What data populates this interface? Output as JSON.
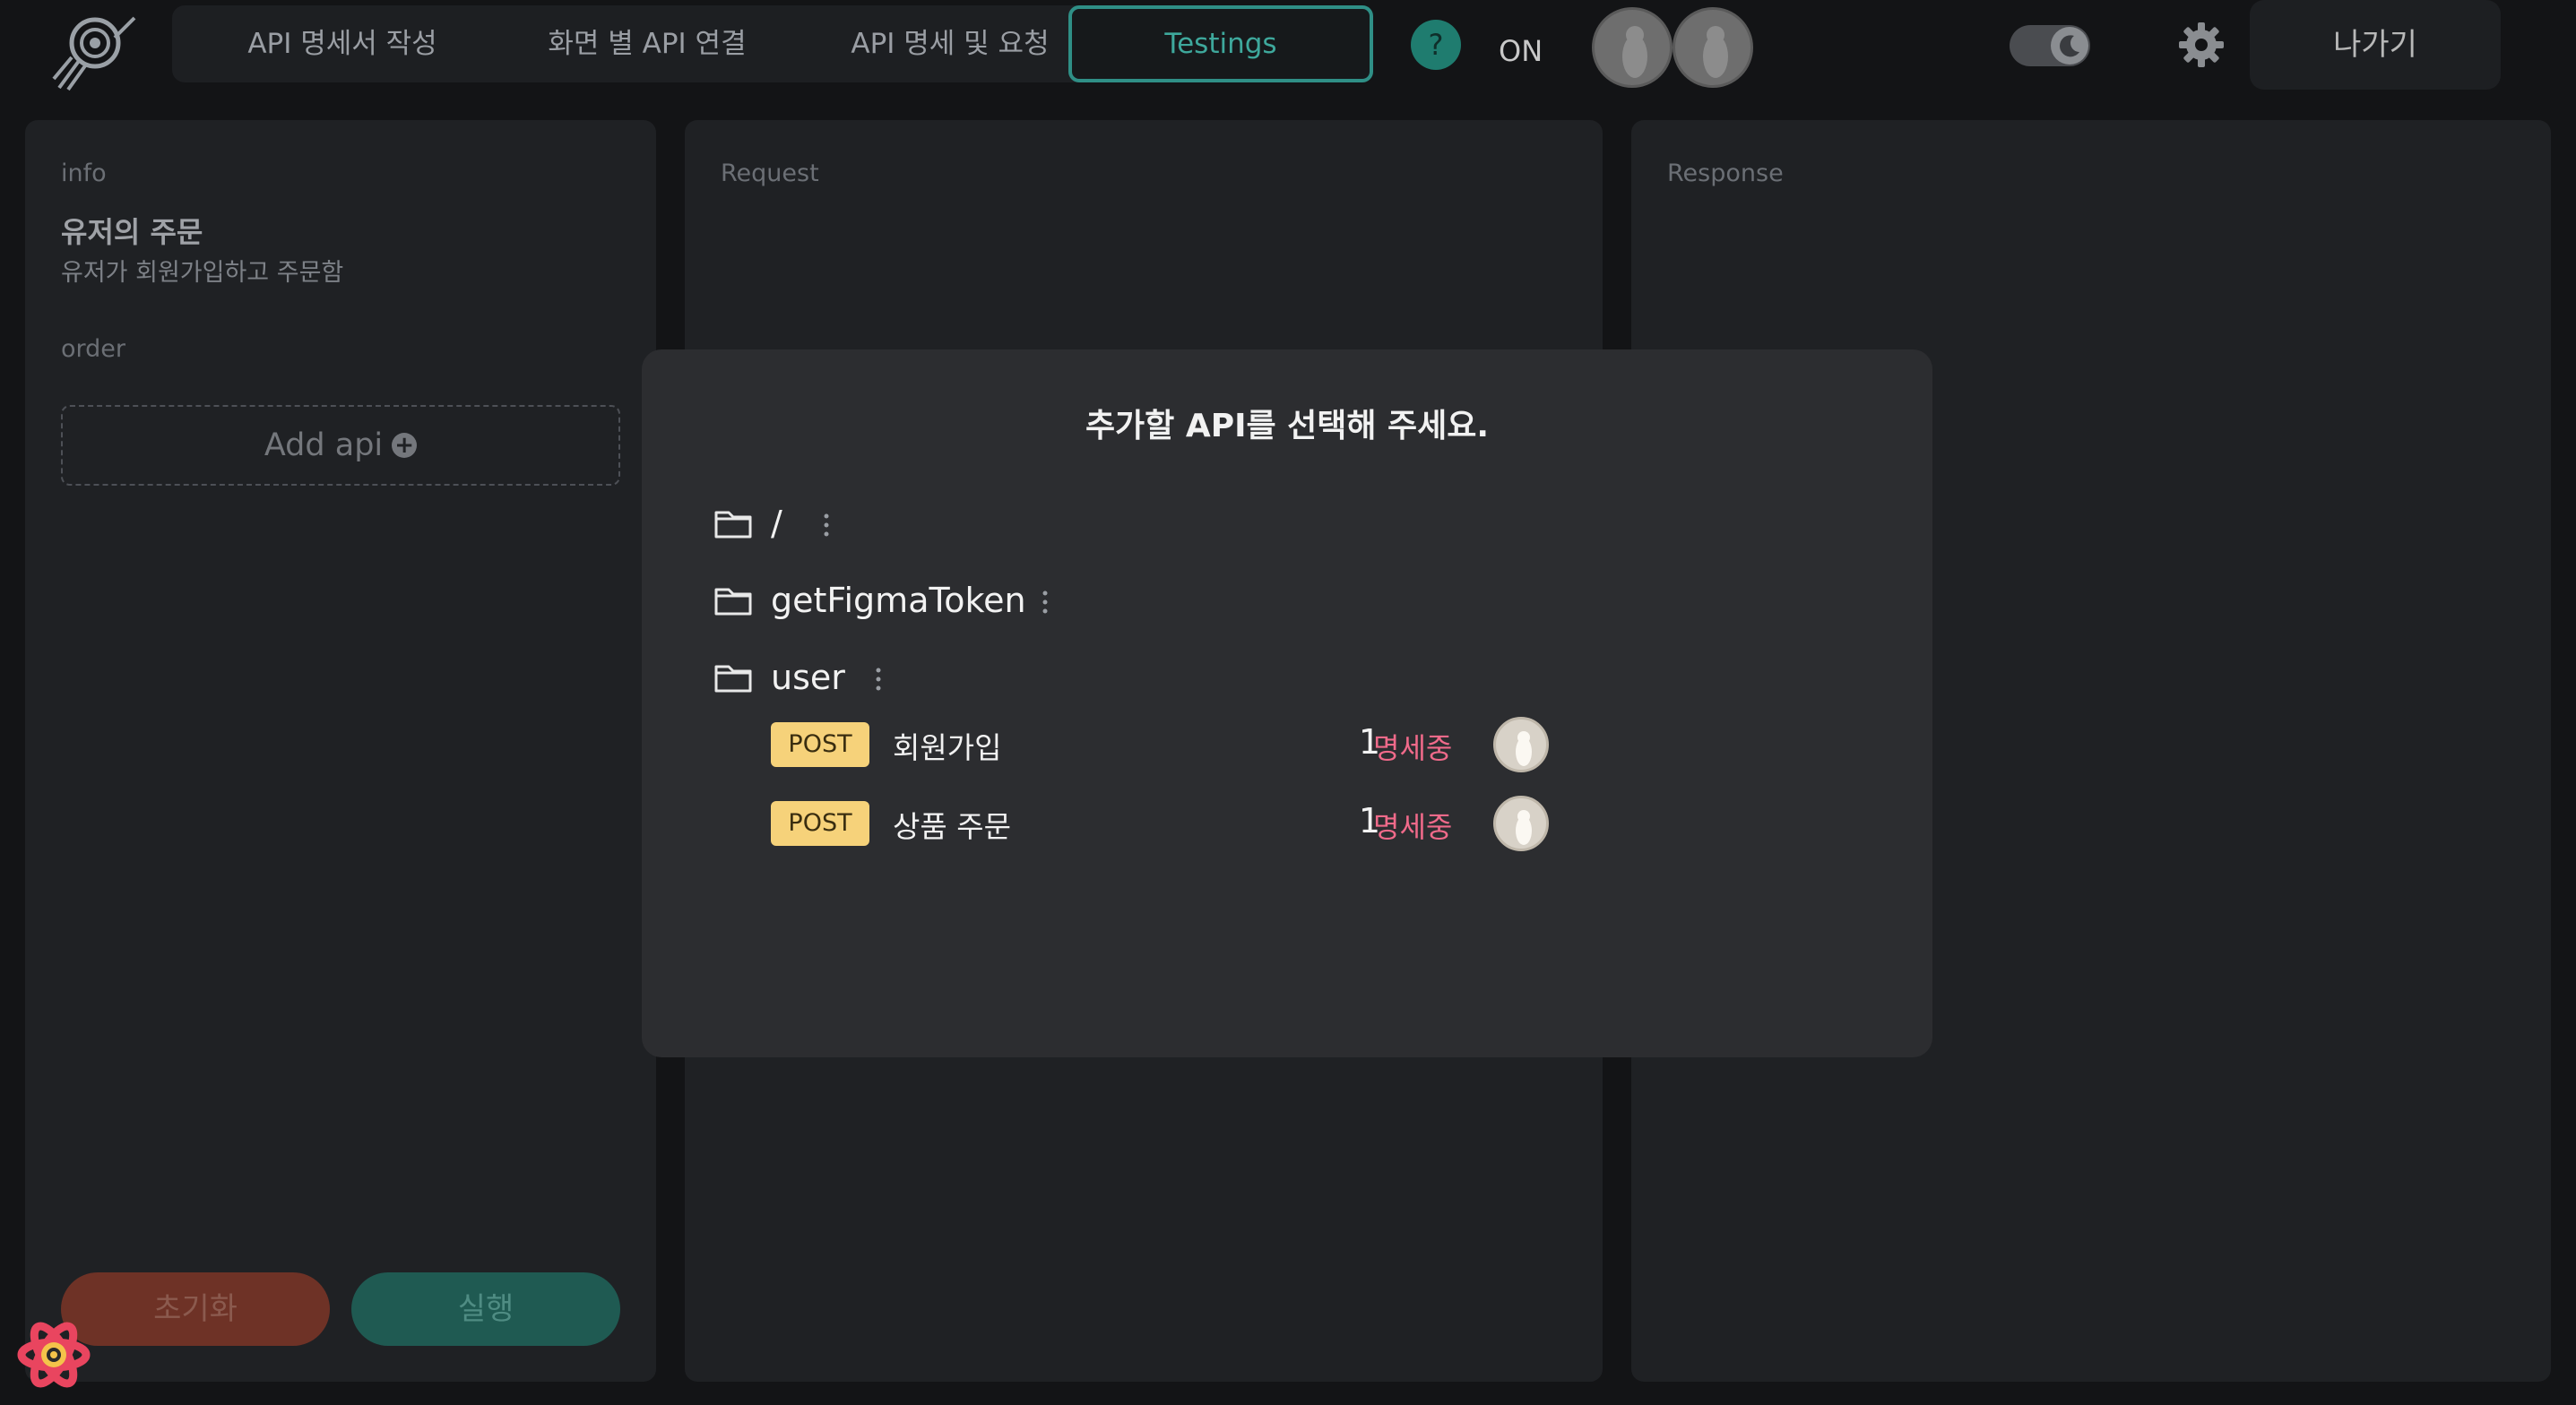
{
  "nav": {
    "tabs": [
      {
        "label": "API 명세서 작성"
      },
      {
        "label": "화면 별 API 연결"
      },
      {
        "label": "API 명세 및 요청"
      },
      {
        "label": "Testings"
      }
    ],
    "help_label": "?",
    "live_status": "ON",
    "exit_label": "나가기",
    "icons": [
      "snail-logo-icon",
      "help-icon",
      "avatar-icon",
      "theme-toggle-moon-icon",
      "gear-icon"
    ]
  },
  "info_panel": {
    "label": "info",
    "title": "유저의 주문",
    "description": "유저가 회원가입하고 주문함",
    "order_label": "order",
    "add_api_label": "Add api",
    "reset_label": "초기화",
    "run_label": "실행"
  },
  "request_panel": {
    "label": "Request"
  },
  "response_panel": {
    "label": "Response"
  },
  "modal": {
    "title": "추가할 API를 선택해 주세요.",
    "folders": [
      {
        "name": "/"
      },
      {
        "name": "getFigmaToken"
      },
      {
        "name": "user"
      }
    ],
    "apis": [
      {
        "method": "POST",
        "name": "회원가입",
        "count": "1",
        "status": "명세중"
      },
      {
        "method": "POST",
        "name": "상품 주문",
        "count": "1",
        "status": "명세중"
      }
    ]
  },
  "colors": {
    "accent_teal": "#2f8f86",
    "method_post": "#f6d27a",
    "status_pink": "#f06a8a",
    "background": "#131416"
  }
}
